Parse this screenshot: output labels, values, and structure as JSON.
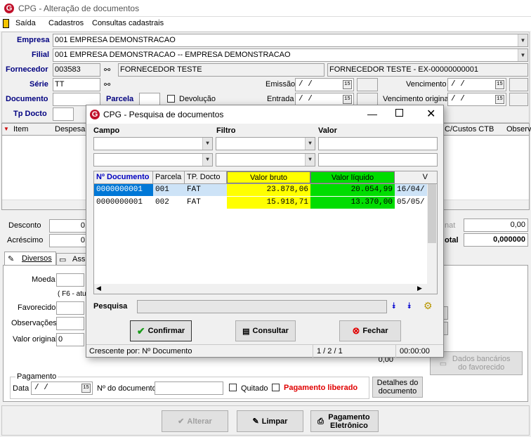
{
  "window": {
    "title": "CPG - Alteração de documentos"
  },
  "menu": {
    "items": [
      "Saída",
      "Cadastros",
      "Consultas cadastrais"
    ]
  },
  "form": {
    "empresa_label": "Empresa",
    "empresa_value": "001 EMPRESA DEMONSTRACAO",
    "filial_label": "Filial",
    "filial_value": "001 EMPRESA DEMONSTRACAO -- EMPRESA DEMONSTRACAO",
    "fornecedor_label": "Fornecedor",
    "fornecedor_code": "003583",
    "fornecedor_name": "FORNECEDOR TESTE",
    "fornecedor_full": "FORNECEDOR TESTE - EX-00000000001",
    "serie_label": "Série",
    "serie_value": "TT",
    "emissao_label": "Emissão",
    "emissao_value": "/ /",
    "vencimento_label": "Vencimento",
    "vencimento_value": "/ /",
    "documento_label": "Documento",
    "parcela_label": "Parcela",
    "devolucao_label": "Devolução",
    "entrada_label": "Entrada",
    "entrada_value": "/ /",
    "venc_original_label": "Vencimento original",
    "venc_original_value": "/ /",
    "tpdocto_label": "Tp Docto"
  },
  "bg_grid": {
    "col_item": "Item",
    "col_despesa": "Despesa",
    "col_ccustos": "C/Custos CTB",
    "col_observ": "Observ"
  },
  "totals": {
    "desconto_label": "Desconto",
    "desconto_value": "0,",
    "acrescimo_label": "Acréscimo",
    "acrescimo_value": "0,",
    "right_label1": "nat",
    "right_value1": "0,00",
    "right_label2": "otal",
    "right_value2": "0,000000"
  },
  "tabs": {
    "diversos": "Diversos",
    "ass": "Ass"
  },
  "lower": {
    "moeda_label": "Moeda",
    "f6_label": "( F6 - atua",
    "favorecido_label": "Favorecido",
    "observacoes_label": "Observações",
    "valor_original_label": "Valor original",
    "valor_original_value": "0",
    "value_000": "0,00",
    "dados_bancarios": "Dados bancários do favorecido",
    "pagamento_label": "Pagamento",
    "data_label": "Data",
    "data_value": "/ /",
    "ndoc_label": "Nº do documento",
    "quitado_label": "Quitado",
    "pag_liberado_label": "Pagamento liberado",
    "detalhes_btn": "Detalhes do documento"
  },
  "bottom": {
    "alterar": "Alterar",
    "limpar": "Limpar",
    "pagamento": "Pagamento Eletrônico"
  },
  "dialog": {
    "title": "CPG - Pesquisa de documentos",
    "campo_label": "Campo",
    "filtro_label": "Filtro",
    "valor_label": "Valor",
    "columns": [
      "Nº Documento",
      "Parcela",
      "TP. Docto",
      "Valor bruto",
      "Valor líquido",
      "V"
    ],
    "rows": [
      [
        "0000000001",
        "001",
        "FAT",
        "23.878,06",
        "20.054,99",
        "16/04/"
      ],
      [
        "0000000001",
        "002",
        "FAT",
        "15.918,71",
        "13.370,00",
        "05/05/"
      ]
    ],
    "pesquisa_label": "Pesquisa",
    "btn_confirmar": "Confirmar",
    "btn_consultar": "Consultar",
    "btn_fechar": "Fechar",
    "status_sort": "Crescente por: Nº Documento",
    "status_page": "1 / 2 / 1",
    "status_time": "00:00:00",
    "colors": {
      "bruto": "#ffff00",
      "liquido": "#00dd00",
      "header_blue": "#0000c0"
    }
  }
}
